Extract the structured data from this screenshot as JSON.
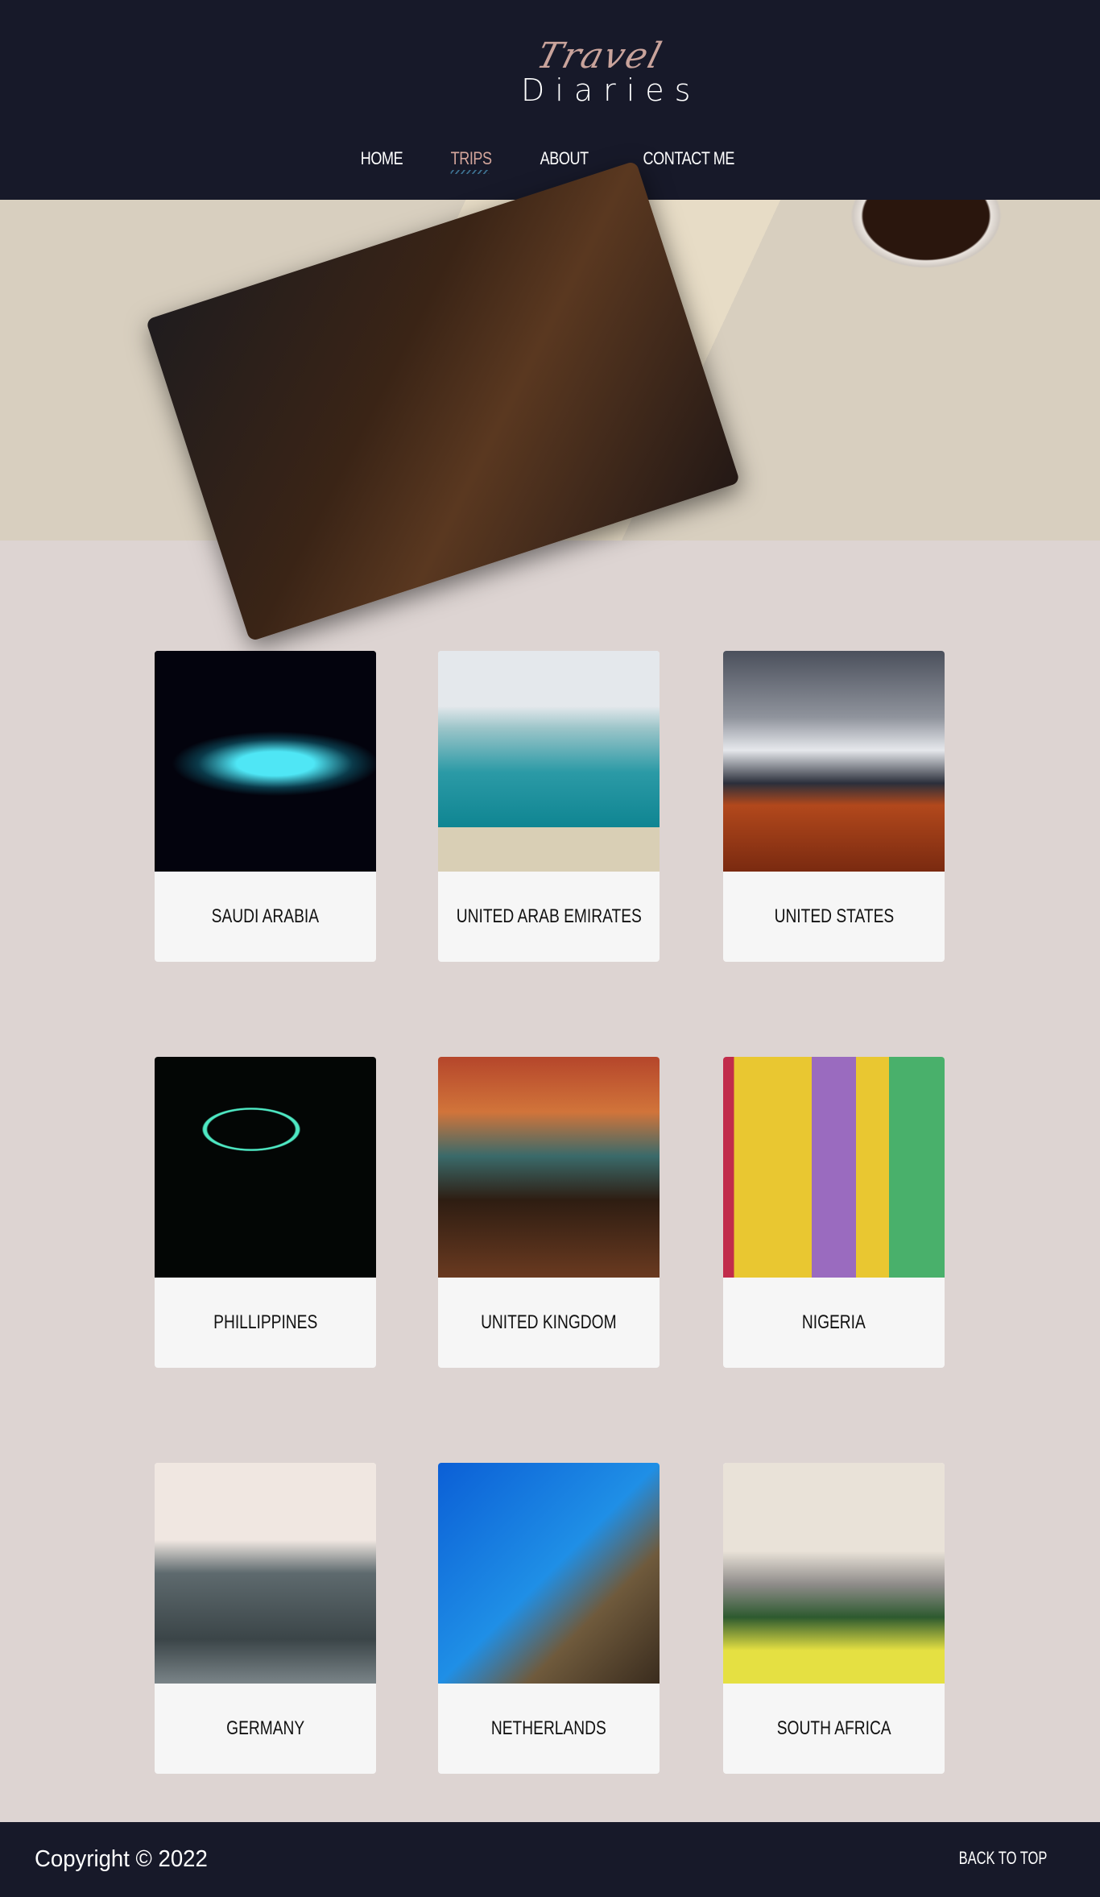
{
  "header": {
    "logo_script": "Travel",
    "logo_main": "Diaries",
    "nav": [
      {
        "label": "HOME",
        "active": false
      },
      {
        "label": "TRIPS",
        "active": true
      },
      {
        "label": "ABOUT",
        "active": false
      },
      {
        "label": "CONTACT ME",
        "active": false
      }
    ]
  },
  "colors": {
    "header_bg": "#171929",
    "page_bg": "#ddd4d2",
    "accent": "#d4a69c",
    "card_bg": "#f6f6f6"
  },
  "trips": [
    {
      "label": "SAUDI ARABIA",
      "image": "Jeddah neon sign"
    },
    {
      "label": "UNITED ARAB EMIRATES",
      "image": "Dubai coastline"
    },
    {
      "label": "UNITED STATES",
      "image": "Mountain autumn trees"
    },
    {
      "label": "PHILLIPPINES",
      "image": "Manila neon sign"
    },
    {
      "label": "UNITED KINGDOM",
      "image": "Beatles drum kit"
    },
    {
      "label": "NIGERIA",
      "image": "Carnival dancer"
    },
    {
      "label": "GERMANY",
      "image": "Berlin fountain statue"
    },
    {
      "label": "NETHERLANDS",
      "image": "Windmill"
    },
    {
      "label": "SOUTH AFRICA",
      "image": "Headwrap mannequin"
    }
  ],
  "footer": {
    "copyright": "Copyright © 2022",
    "back_to_top": "BACK TO TOP"
  }
}
